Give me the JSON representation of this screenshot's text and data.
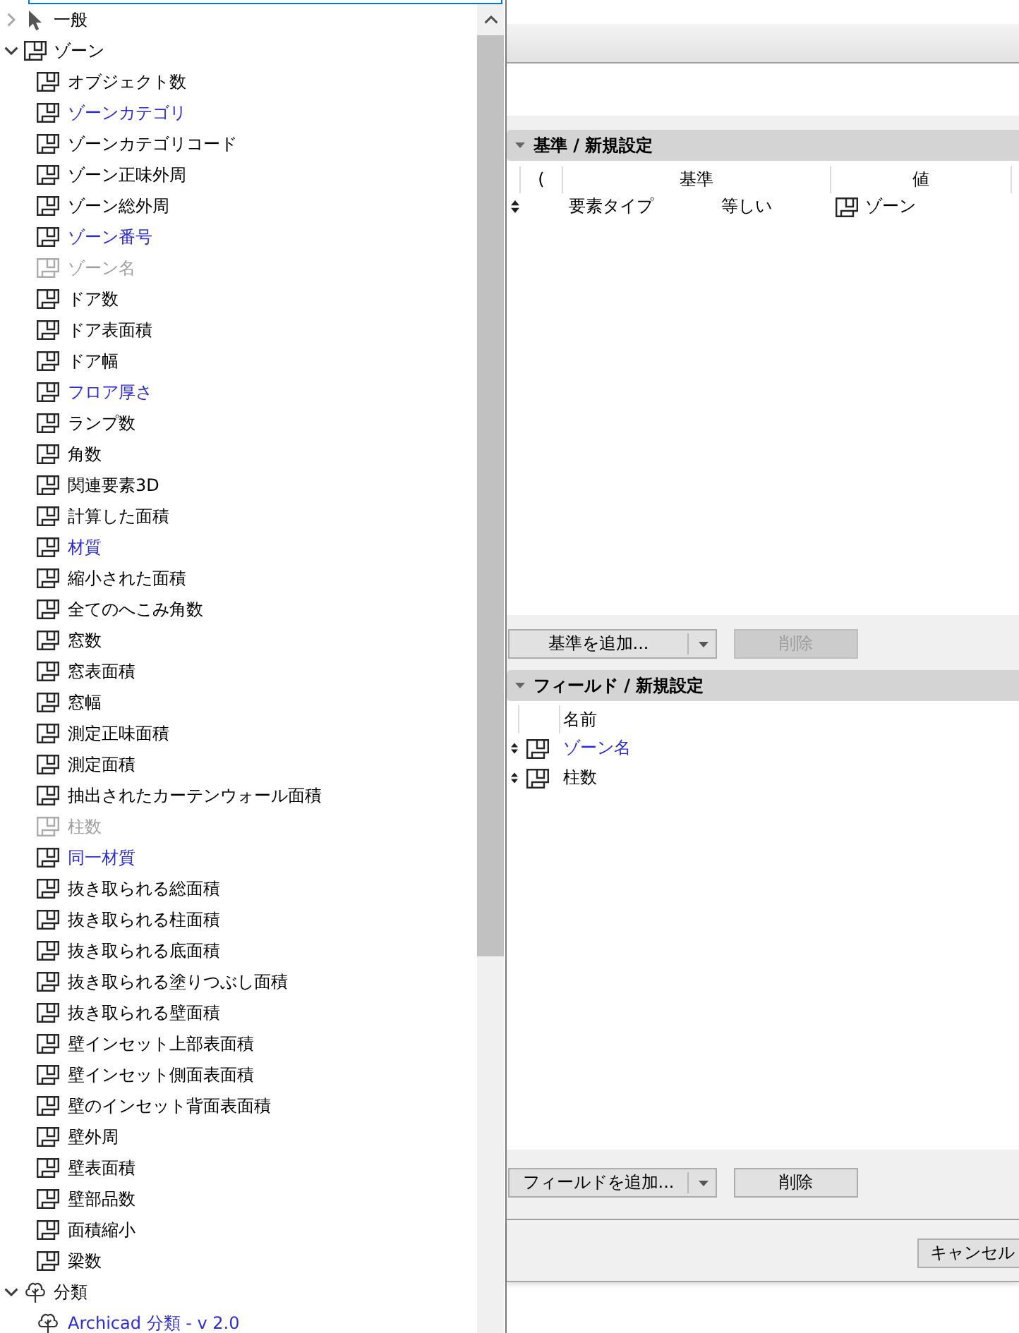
{
  "tree": {
    "items": [
      {
        "label": "一般",
        "kind": "general",
        "expanded": false
      },
      {
        "label": "ゾーン",
        "kind": "zone",
        "expanded": true,
        "children": [
          {
            "label": "オブジェクト数",
            "color": "#000000",
            "disabled": false
          },
          {
            "label": "ゾーンカテゴリ",
            "color": "#2b2bdb",
            "disabled": false
          },
          {
            "label": "ゾーンカテゴリコード",
            "color": "#000000",
            "disabled": false
          },
          {
            "label": "ゾーン正味外周",
            "color": "#000000",
            "disabled": false
          },
          {
            "label": "ゾーン総外周",
            "color": "#000000",
            "disabled": false
          },
          {
            "label": "ゾーン番号",
            "color": "#2b2bdb",
            "disabled": false
          },
          {
            "label": "ゾーン名",
            "color": "#a0a0a0",
            "disabled": true
          },
          {
            "label": "ドア数",
            "color": "#000000",
            "disabled": false
          },
          {
            "label": "ドア表面積",
            "color": "#000000",
            "disabled": false
          },
          {
            "label": "ドア幅",
            "color": "#000000",
            "disabled": false
          },
          {
            "label": "フロア厚さ",
            "color": "#2b2bdb",
            "disabled": false
          },
          {
            "label": "ランプ数",
            "color": "#000000",
            "disabled": false
          },
          {
            "label": "角数",
            "color": "#000000",
            "disabled": false
          },
          {
            "label": "関連要素3D",
            "color": "#000000",
            "disabled": false
          },
          {
            "label": "計算した面積",
            "color": "#000000",
            "disabled": false
          },
          {
            "label": "材質",
            "color": "#2b2bdb",
            "disabled": false
          },
          {
            "label": "縮小された面積",
            "color": "#000000",
            "disabled": false
          },
          {
            "label": "全てのへこみ角数",
            "color": "#000000",
            "disabled": false
          },
          {
            "label": "窓数",
            "color": "#000000",
            "disabled": false
          },
          {
            "label": "窓表面積",
            "color": "#000000",
            "disabled": false
          },
          {
            "label": "窓幅",
            "color": "#000000",
            "disabled": false
          },
          {
            "label": "測定正味面積",
            "color": "#000000",
            "disabled": false
          },
          {
            "label": "測定面積",
            "color": "#000000",
            "disabled": false
          },
          {
            "label": "抽出されたカーテンウォール面積",
            "color": "#000000",
            "disabled": false
          },
          {
            "label": "柱数",
            "color": "#a0a0a0",
            "disabled": true
          },
          {
            "label": "同一材質",
            "color": "#2b2bdb",
            "disabled": false
          },
          {
            "label": "抜き取られる総面積",
            "color": "#000000",
            "disabled": false
          },
          {
            "label": "抜き取られる柱面積",
            "color": "#000000",
            "disabled": false
          },
          {
            "label": "抜き取られる底面積",
            "color": "#000000",
            "disabled": false
          },
          {
            "label": "抜き取られる塗りつぶし面積",
            "color": "#000000",
            "disabled": false
          },
          {
            "label": "抜き取られる壁面積",
            "color": "#000000",
            "disabled": false
          },
          {
            "label": "壁インセット上部表面積",
            "color": "#000000",
            "disabled": false
          },
          {
            "label": "壁インセット側面表面積",
            "color": "#000000",
            "disabled": false
          },
          {
            "label": "壁のインセット背面表面積",
            "color": "#000000",
            "disabled": false
          },
          {
            "label": "壁外周",
            "color": "#000000",
            "disabled": false
          },
          {
            "label": "壁表面積",
            "color": "#000000",
            "disabled": false
          },
          {
            "label": "壁部品数",
            "color": "#000000",
            "disabled": false
          },
          {
            "label": "面積縮小",
            "color": "#000000",
            "disabled": false
          },
          {
            "label": "梁数",
            "color": "#000000",
            "disabled": false
          }
        ]
      },
      {
        "label": "分類",
        "kind": "classification",
        "expanded": true,
        "children": [
          {
            "label": "Archicad 分類 - v 2.0",
            "color": "#2b2bdb",
            "disabled": false
          }
        ]
      }
    ]
  },
  "criteria": {
    "title": "基準 / 新規設定",
    "expanded": true,
    "columns": [
      "(",
      "基準",
      "値"
    ],
    "rows": [
      {
        "property": "要素タイプ",
        "operator": "等しい",
        "value": "ゾーン"
      }
    ],
    "add_button": "基準を追加...",
    "delete_button": {
      "label": "削除",
      "disabled": true
    }
  },
  "fields": {
    "title": "フィールド / 新規設定",
    "expanded": true,
    "columns": [
      "名前"
    ],
    "rows": [
      {
        "name": "ゾーン名",
        "color": "#2b2bdb"
      },
      {
        "name": "柱数",
        "color": "#000000"
      }
    ],
    "add_button": "フィールドを追加...",
    "delete_button": {
      "label": "削除",
      "disabled": false
    }
  },
  "footer": {
    "buttons": [
      "キャンセル"
    ]
  }
}
